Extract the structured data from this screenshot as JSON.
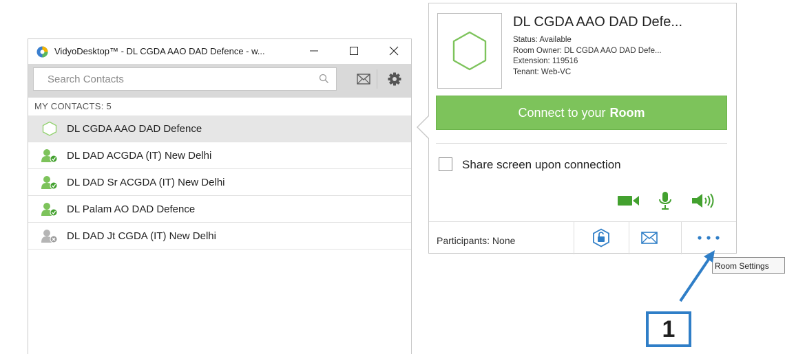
{
  "window": {
    "title": "VidyoDesktop™  - DL CGDA AAO DAD Defence - w...",
    "minimize_icon": "minimize-icon",
    "maximize_icon": "maximize-icon",
    "close_icon": "close-icon"
  },
  "toolbar": {
    "search_placeholder": "Search Contacts",
    "search_value": "",
    "search_icon": "search-icon",
    "mail_icon": "mail-icon",
    "settings_icon": "gear-icon"
  },
  "contacts": {
    "header": "MY CONTACTS: 5",
    "items": [
      {
        "name": "DL CGDA AAO DAD Defence",
        "icon": "room-hexagon-icon",
        "status": "room",
        "selected": true
      },
      {
        "name": "DL DAD ACGDA (IT) New Delhi",
        "icon": "user-available-icon",
        "status": "available",
        "selected": false
      },
      {
        "name": "DL DAD Sr ACGDA (IT) New Delhi",
        "icon": "user-available-icon",
        "status": "available",
        "selected": false
      },
      {
        "name": "DL Palam AO DAD Defence",
        "icon": "user-available-icon",
        "status": "available",
        "selected": false
      },
      {
        "name": "DL DAD Jt CGDA (IT) New Delhi",
        "icon": "user-offline-icon",
        "status": "offline",
        "selected": false
      }
    ]
  },
  "room": {
    "title": "DL CGDA AAO DAD Defe...",
    "status": "Status: Available",
    "owner": "Room Owner: DL CGDA AAO DAD Defe...",
    "extension": "Extension: 119516",
    "tenant": "Tenant: Web-VC",
    "connect_prefix": "Connect to your",
    "connect_bold": "Room",
    "share_label": "Share screen upon connection",
    "share_checked": false,
    "participants": "Participants: None",
    "icons": [
      "camera-icon",
      "microphone-icon",
      "speaker-icon",
      "lock-icon",
      "mail-icon",
      "more-options-icon"
    ]
  },
  "tooltip": "Room Settings",
  "callout_number": "1",
  "colors": {
    "accent_green": "#7dc35b",
    "icon_green": "#43a12f",
    "icon_blue": "#2f7ec7",
    "callout_blue": "#2f7ec7",
    "offline_gray": "#a8a8a8"
  }
}
